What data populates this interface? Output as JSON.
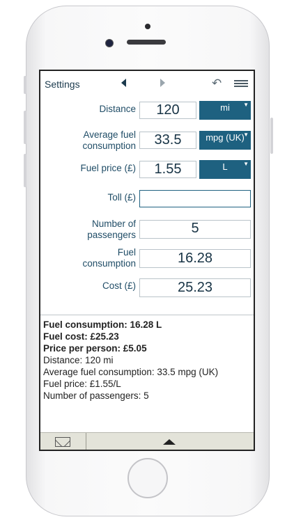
{
  "header": {
    "title": "Settings"
  },
  "inputs": {
    "distance": {
      "label": "Distance",
      "value": "120",
      "unit": "mi"
    },
    "avg_fuel": {
      "label_line1": "Average fuel",
      "label_line2": "consumption",
      "value": "33.5",
      "unit": "mpg (UK)"
    },
    "fuel_price": {
      "label": "Fuel price (£)",
      "value": "1.55",
      "unit": "L"
    },
    "toll": {
      "label": "Toll (£)",
      "value": ""
    },
    "passengers": {
      "label_line1": "Number of",
      "label_line2": "passengers",
      "value": "5"
    },
    "fuel_consumption": {
      "label_line1": "Fuel",
      "label_line2": "consumption",
      "value": "16.28"
    },
    "cost": {
      "label": "Cost (£)",
      "value": "25.23"
    }
  },
  "summary": {
    "fuel_consumption": "Fuel consumption: 16.28 L",
    "fuel_cost": "Fuel cost: £25.23",
    "price_per_person": "Price per person: £5.05",
    "distance": "Distance: 120 mi",
    "avg_consumption": "Average fuel consumption: 33.5 mpg (UK)",
    "fuel_price": "Fuel price: £1.55/L",
    "passengers": "Number of passengers: 5"
  },
  "icons": {
    "prev": "left-arrow-icon",
    "next": "right-arrow-icon",
    "undo": "undo-icon",
    "menu": "menu-icon",
    "mail": "mail-icon",
    "expand": "up-arrow-icon"
  },
  "colors": {
    "accent": "#1e6180",
    "label": "#1f4c66"
  }
}
